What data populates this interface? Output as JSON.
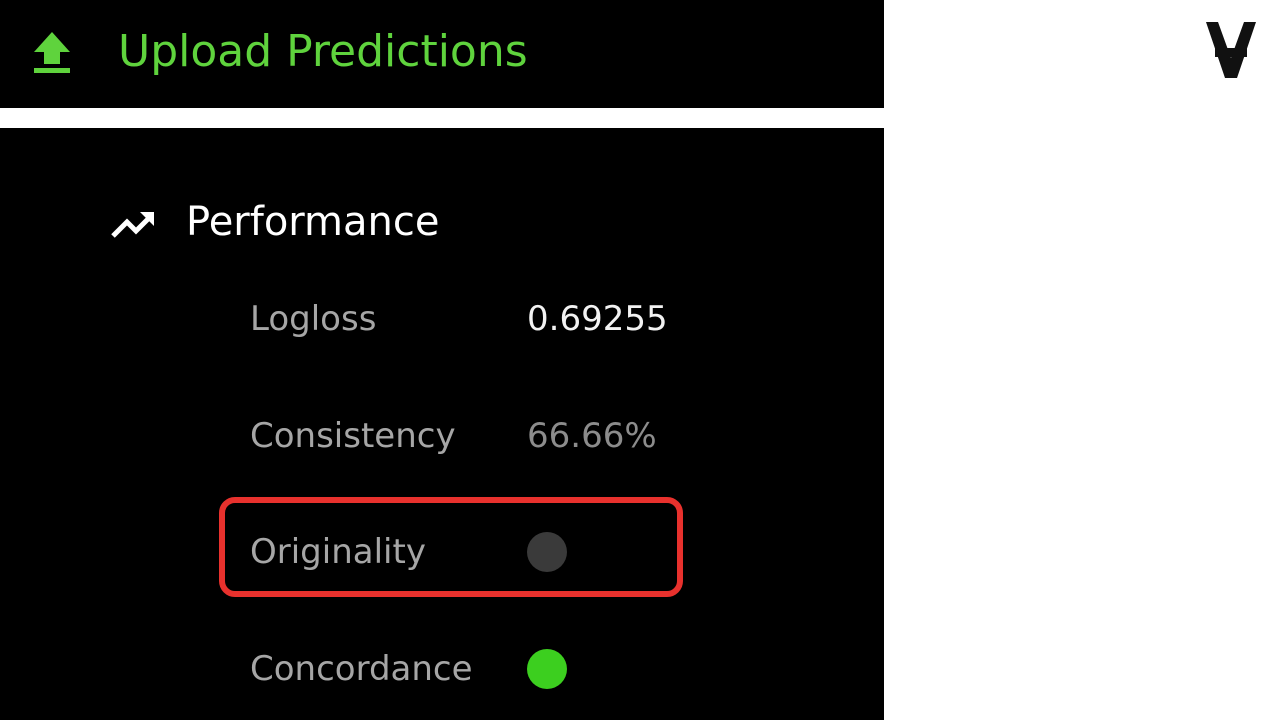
{
  "header": {
    "title": "Upload Predictions",
    "upload_icon": "upload-arrow-icon",
    "accent_color": "#5fd33d"
  },
  "brand": {
    "logo_icon": "numerai-logo-icon"
  },
  "performance": {
    "title": "Performance",
    "icon": "trending-up-icon",
    "metrics": [
      {
        "label": "Logloss",
        "value": "0.69255"
      },
      {
        "label": "Consistency",
        "value": "66.66%"
      },
      {
        "label": "Originality",
        "status": "pending",
        "status_color": "#3a3a3a"
      },
      {
        "label": "Concordance",
        "status": "passed",
        "status_color": "#3ccf1f"
      }
    ]
  },
  "annotation": {
    "highlight_color": "#e8312d"
  }
}
